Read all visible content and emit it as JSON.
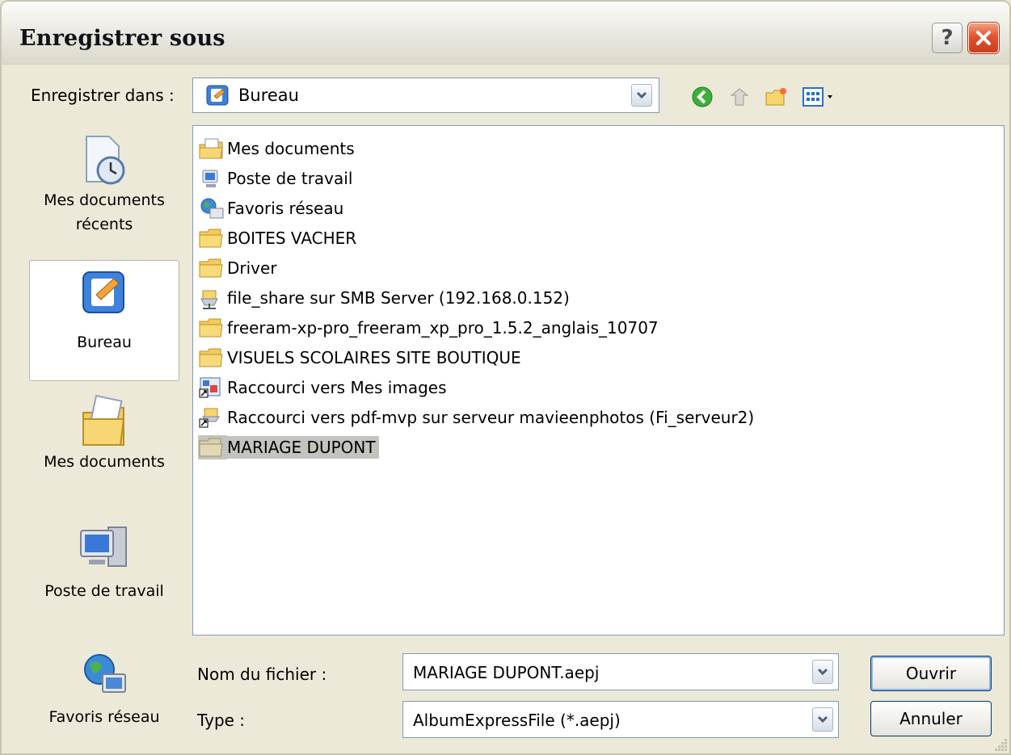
{
  "window": {
    "title": "Enregistrer sous"
  },
  "titlebar": {
    "help_label": "?"
  },
  "toolbar": {
    "save_in_label": "Enregistrer dans :",
    "location": "Bureau",
    "icons": [
      "back-icon",
      "up-folder-icon",
      "new-folder-icon",
      "view-menu-icon"
    ]
  },
  "places": [
    {
      "label": "Mes documents récents",
      "icon": "recent-documents-icon"
    },
    {
      "label": "Bureau",
      "icon": "desktop-icon",
      "selected": true
    },
    {
      "label": "Mes documents",
      "icon": "my-documents-icon"
    },
    {
      "label": "Poste de travail",
      "icon": "my-computer-icon"
    },
    {
      "label": "Favoris réseau",
      "icon": "network-places-icon"
    }
  ],
  "files": [
    {
      "name": "Mes documents",
      "icon": "my-documents-icon"
    },
    {
      "name": "Poste de travail",
      "icon": "my-computer-icon"
    },
    {
      "name": "Favoris réseau",
      "icon": "network-places-icon"
    },
    {
      "name": "BOITES VACHER",
      "icon": "folder-icon"
    },
    {
      "name": "Driver",
      "icon": "folder-icon"
    },
    {
      "name": "file_share sur SMB Server (192.168.0.152)",
      "icon": "network-drive-icon"
    },
    {
      "name": "freeram-xp-pro_freeram_xp_pro_1.5.2_anglais_10707",
      "icon": "folder-icon"
    },
    {
      "name": "VISUELS SCOLAIRES SITE BOUTIQUE",
      "icon": "folder-icon"
    },
    {
      "name": "Raccourci vers Mes images",
      "icon": "shortcut-icon"
    },
    {
      "name": "Raccourci vers pdf-mvp sur serveur mavieenphotos (Fi_serveur2)",
      "icon": "shortcut-icon"
    },
    {
      "name": "MARIAGE DUPONT",
      "icon": "folder-icon",
      "selected": true
    }
  ],
  "filename": {
    "label": "Nom du fichier :",
    "value": "MARIAGE DUPONT.aepj"
  },
  "filetype": {
    "label": "Type :",
    "value": "AlbumExpressFile (*.aepj)"
  },
  "buttons": {
    "open": "Ouvrir",
    "cancel": "Annuler"
  }
}
